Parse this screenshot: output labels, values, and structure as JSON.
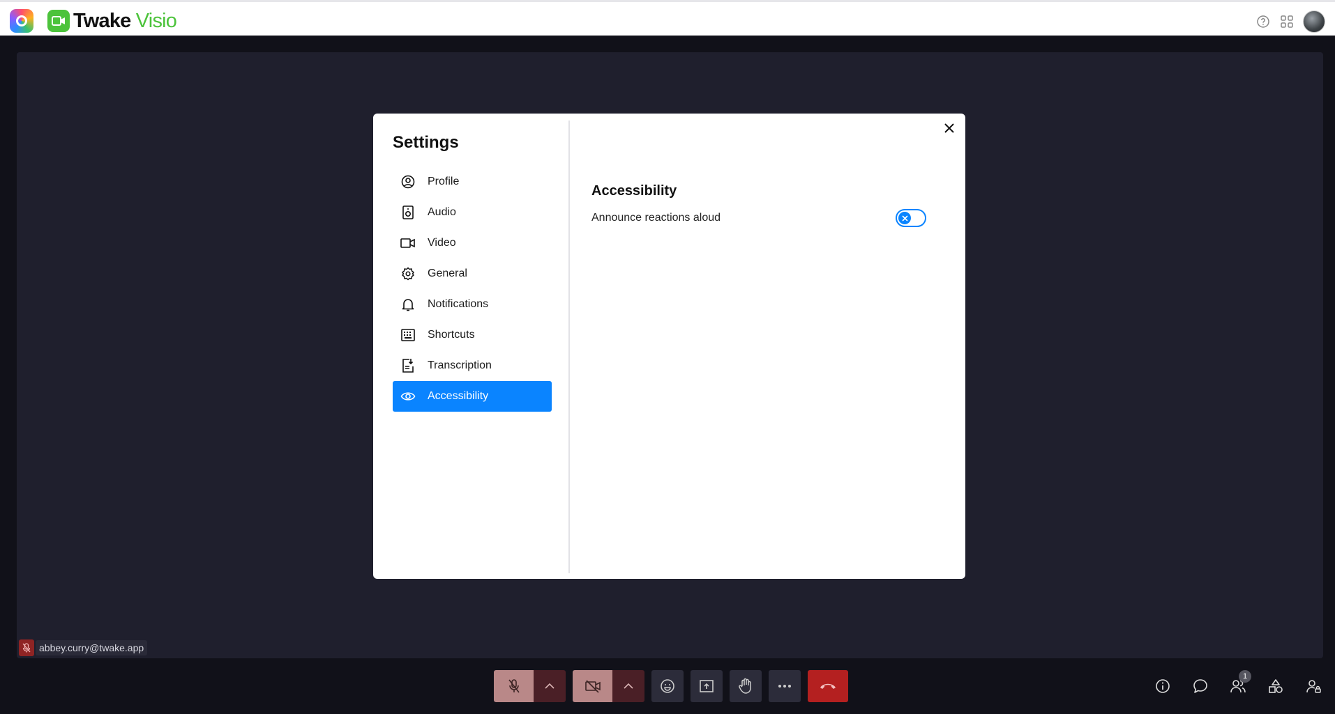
{
  "header": {
    "brand_part1": "Twake",
    "brand_part2": "Visio",
    "colors": {
      "brand_green": "#4cc33b"
    }
  },
  "participant": {
    "name": "abbey.curry@twake.app"
  },
  "settings": {
    "title": "Settings",
    "nav": [
      {
        "label": "Profile",
        "icon": "profile-icon"
      },
      {
        "label": "Audio",
        "icon": "speaker-icon"
      },
      {
        "label": "Video",
        "icon": "video-camera-icon"
      },
      {
        "label": "General",
        "icon": "gear-icon"
      },
      {
        "label": "Notifications",
        "icon": "bell-icon"
      },
      {
        "label": "Shortcuts",
        "icon": "keyboard-icon"
      },
      {
        "label": "Transcription",
        "icon": "transcription-icon"
      },
      {
        "label": "Accessibility",
        "icon": "eye-icon",
        "active": true
      }
    ],
    "section_title": "Accessibility",
    "options": [
      {
        "label": "Announce reactions aloud",
        "enabled": false
      }
    ],
    "colors": {
      "accent": "#0a84ff"
    }
  },
  "controls": {
    "participants_count": "1"
  }
}
